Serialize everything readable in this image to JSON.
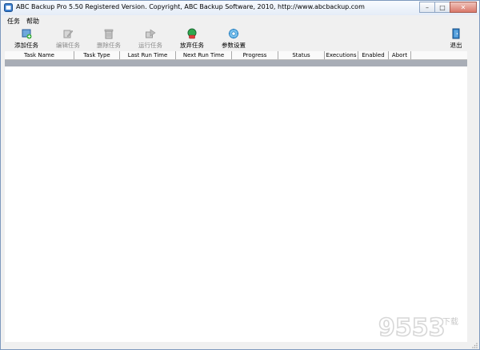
{
  "window": {
    "title": "ABC Backup Pro 5.50   Registered Version.  Copyright,  ABC Backup Software, 2010,   http://www.abcbackup.com",
    "controls": {
      "minimize": "–",
      "maximize": "□",
      "close": "✕"
    }
  },
  "menu": {
    "items": [
      {
        "label": "任务"
      },
      {
        "label": "帮助"
      }
    ]
  },
  "toolbar": {
    "buttons": [
      {
        "label": "添加任务",
        "icon": "add-task-icon",
        "enabled": true
      },
      {
        "label": "编辑任务",
        "icon": "edit-task-icon",
        "enabled": false
      },
      {
        "label": "删除任务",
        "icon": "delete-task-icon",
        "enabled": false
      },
      {
        "label": "运行任务",
        "icon": "run-task-icon",
        "enabled": false
      },
      {
        "label": "放弃任务",
        "icon": "abort-task-icon",
        "enabled": true
      },
      {
        "label": "参数设置",
        "icon": "settings-icon",
        "enabled": true
      }
    ],
    "exit": {
      "label": "退出",
      "icon": "exit-door-icon"
    }
  },
  "grid": {
    "columns": [
      {
        "label": "Task Name"
      },
      {
        "label": "Task Type"
      },
      {
        "label": "Last Run Time"
      },
      {
        "label": "Next Run Time"
      },
      {
        "label": "Progress"
      },
      {
        "label": "Status"
      },
      {
        "label": "Executions"
      },
      {
        "label": "Enabled"
      },
      {
        "label": "Abort"
      }
    ],
    "rows": []
  },
  "watermark": {
    "text": "9553",
    "subtext": "下载"
  },
  "colors": {
    "accent": "#2a73c6",
    "header_strip": "#a8adb6",
    "close_button": "#d9786a"
  }
}
